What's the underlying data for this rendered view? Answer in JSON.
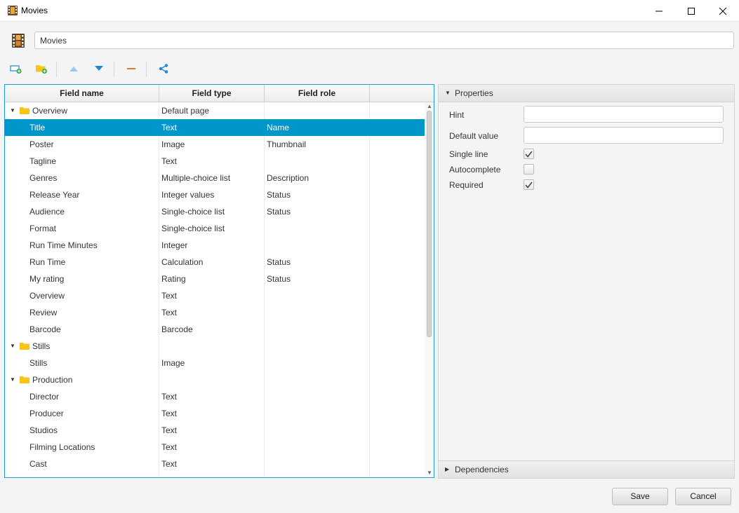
{
  "window": {
    "title": "Movies"
  },
  "name_input": {
    "value": "Movies"
  },
  "table": {
    "columns": [
      "Field name",
      "Field type",
      "Field role"
    ],
    "rows": [
      {
        "name": "Overview",
        "type": "Default page",
        "role": "",
        "kind": "group"
      },
      {
        "name": "Title",
        "type": "Text",
        "role": "Name",
        "kind": "field",
        "selected": true
      },
      {
        "name": "Poster",
        "type": "Image",
        "role": "Thumbnail",
        "kind": "field"
      },
      {
        "name": "Tagline",
        "type": "Text",
        "role": "",
        "kind": "field"
      },
      {
        "name": "Genres",
        "type": "Multiple-choice list",
        "role": "Description",
        "kind": "field"
      },
      {
        "name": "Release Year",
        "type": "Integer values",
        "role": "Status",
        "kind": "field"
      },
      {
        "name": "Audience",
        "type": "Single-choice list",
        "role": "Status",
        "kind": "field"
      },
      {
        "name": "Format",
        "type": "Single-choice list",
        "role": "",
        "kind": "field"
      },
      {
        "name": "Run Time Minutes",
        "type": "Integer",
        "role": "",
        "kind": "field"
      },
      {
        "name": "Run Time",
        "type": "Calculation",
        "role": "Status",
        "kind": "field"
      },
      {
        "name": "My rating",
        "type": "Rating",
        "role": "Status",
        "kind": "field"
      },
      {
        "name": "Overview",
        "type": "Text",
        "role": "",
        "kind": "field"
      },
      {
        "name": "Review",
        "type": "Text",
        "role": "",
        "kind": "field"
      },
      {
        "name": "Barcode",
        "type": "Barcode",
        "role": "",
        "kind": "field"
      },
      {
        "name": "Stills",
        "type": "",
        "role": "",
        "kind": "group"
      },
      {
        "name": "Stills",
        "type": "Image",
        "role": "",
        "kind": "field"
      },
      {
        "name": "Production",
        "type": "",
        "role": "",
        "kind": "group"
      },
      {
        "name": "Director",
        "type": "Text",
        "role": "",
        "kind": "field"
      },
      {
        "name": "Producer",
        "type": "Text",
        "role": "",
        "kind": "field"
      },
      {
        "name": "Studios",
        "type": "Text",
        "role": "",
        "kind": "field"
      },
      {
        "name": "Filming Locations",
        "type": "Text",
        "role": "",
        "kind": "field"
      },
      {
        "name": "Cast",
        "type": "Text",
        "role": "",
        "kind": "field"
      }
    ]
  },
  "properties": {
    "header": "Properties",
    "hint_label": "Hint",
    "hint_value": "",
    "default_value_label": "Default value",
    "default_value": "",
    "single_line_label": "Single line",
    "single_line_checked": true,
    "autocomplete_label": "Autocomplete",
    "autocomplete_checked": false,
    "required_label": "Required",
    "required_checked": true
  },
  "dependencies": {
    "header": "Dependencies"
  },
  "footer": {
    "save_label": "Save",
    "cancel_label": "Cancel"
  },
  "colors": {
    "accent": "#0096c9",
    "folder": "#f5c518",
    "toolbar_blue": "#1e88d6",
    "remove_orange": "#e0772a"
  }
}
